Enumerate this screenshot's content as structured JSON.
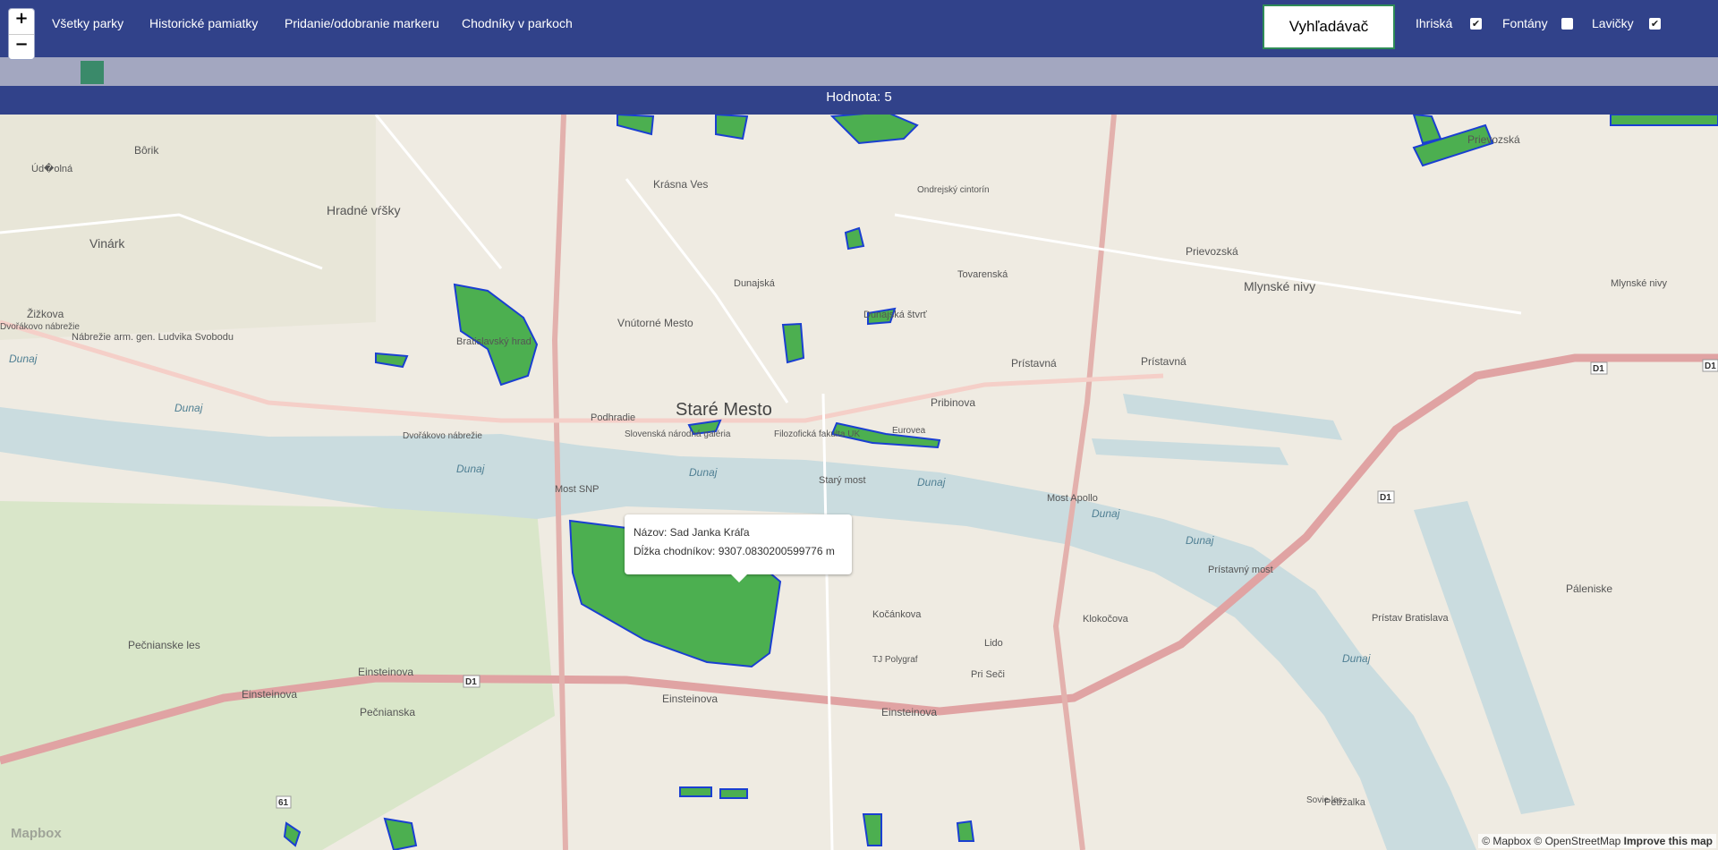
{
  "zoom": {
    "in_label": "+",
    "out_label": "−"
  },
  "nav": {
    "all_parks": "Všetky parky",
    "monuments": "Historické pamiatky",
    "markers": "Pridanie/odobranie markeru",
    "paths": "Chodníky v parkoch"
  },
  "search_button": "Vyhľadávač",
  "filters": [
    {
      "label": "Ihriská",
      "checked": true
    },
    {
      "label": "Fontány",
      "checked": false
    },
    {
      "label": "Lavičky",
      "checked": true
    }
  ],
  "slider": {
    "value": 5
  },
  "value_label": "Hodnota: 5",
  "map": {
    "city": "Staré Mesto",
    "labels": [
      "Dunaj",
      "Dunaj",
      "Dunaj",
      "Dunaj",
      "Dunaj",
      "Dunaj",
      "Dunaj",
      "Dunaj",
      "Most SNP",
      "Starý most",
      "Most Apollo",
      "Prístavný most",
      "Einsteinova",
      "Einsteinova",
      "Einsteinova",
      "Einsteinova",
      "Dvořákovo nábrežie",
      "Dvořákovo nábrežie",
      "Nábrežie arm. gen. Ludvika Svobodu",
      "Pribinova",
      "Prístavná",
      "Prístavná",
      "Mlynské nivy",
      "Mlynské nivy",
      "Prievozská",
      "Prievozská",
      "Pečnianske les",
      "Pečnianska",
      "Bratislavský hrad",
      "Slovenská národná galéria",
      "Filozofická fakulta UK",
      "Eurovea",
      "Vnútorné Mesto",
      "Krásna Ves",
      "Hradné vŕšky",
      "Ondrejský cintorín",
      "Kočánkova",
      "Klokočova",
      "Lido",
      "Pri Seči",
      "TJ Polygraf",
      "Petržalka",
      "Prístav Bratislava",
      "Sovie les",
      "Páleniske",
      "Podhradie",
      "Dunajská štvrť",
      "Tovarenská",
      "Žižkova",
      "Dunajská",
      "Vinárk",
      "Úd�olná",
      "Bôrik"
    ],
    "road_labels": [
      "D1",
      "D1",
      "D1",
      "D1",
      "61"
    ]
  },
  "popup": {
    "name_line": "Názov: Sad Janka Kráľa",
    "length_line": "Dĺžka chodníkov: 9307.0830200599776 m"
  },
  "attribution": {
    "text": "© Mapbox © OpenStreetMap",
    "link": "Improve this map"
  },
  "logo": "Mapbox",
  "colors": {
    "header": "#31428a",
    "slider_track": "#a3a7c0",
    "slider_thumb": "#3a8a6a",
    "park_fill": "#4caf50",
    "park_outline": "#1a3fd1",
    "river": "#cadcdf",
    "land": "#efebe2"
  }
}
